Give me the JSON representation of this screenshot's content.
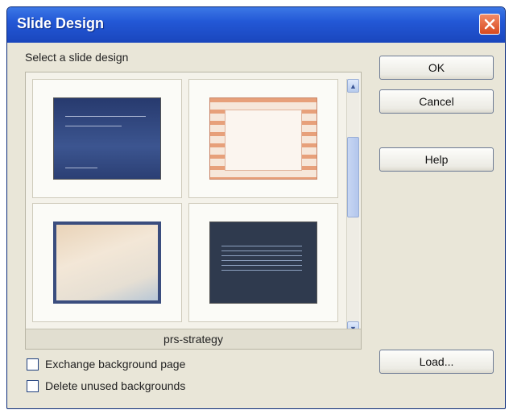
{
  "window": {
    "title": "Slide Design",
    "close_icon": "close-icon"
  },
  "select_label": "Select a slide design",
  "designs": [
    {
      "name": "blue-slide-thumbnail"
    },
    {
      "name": "orange-stripes-slide-thumbnail"
    },
    {
      "name": "beige-slide-thumbnail"
    },
    {
      "name": "dark-slide-thumbnail"
    }
  ],
  "selected_design_name": "prs-strategy",
  "buttons": {
    "ok": "OK",
    "cancel": "Cancel",
    "help": "Help",
    "load": "Load..."
  },
  "options": {
    "exchange_background": {
      "label": "Exchange background page",
      "checked": false
    },
    "delete_unused": {
      "label": "Delete unused backgrounds",
      "checked": false
    }
  },
  "colors": {
    "titlebar": "#2358d6",
    "close_button": "#d84a20",
    "dialog_background": "#e9e6d8"
  }
}
